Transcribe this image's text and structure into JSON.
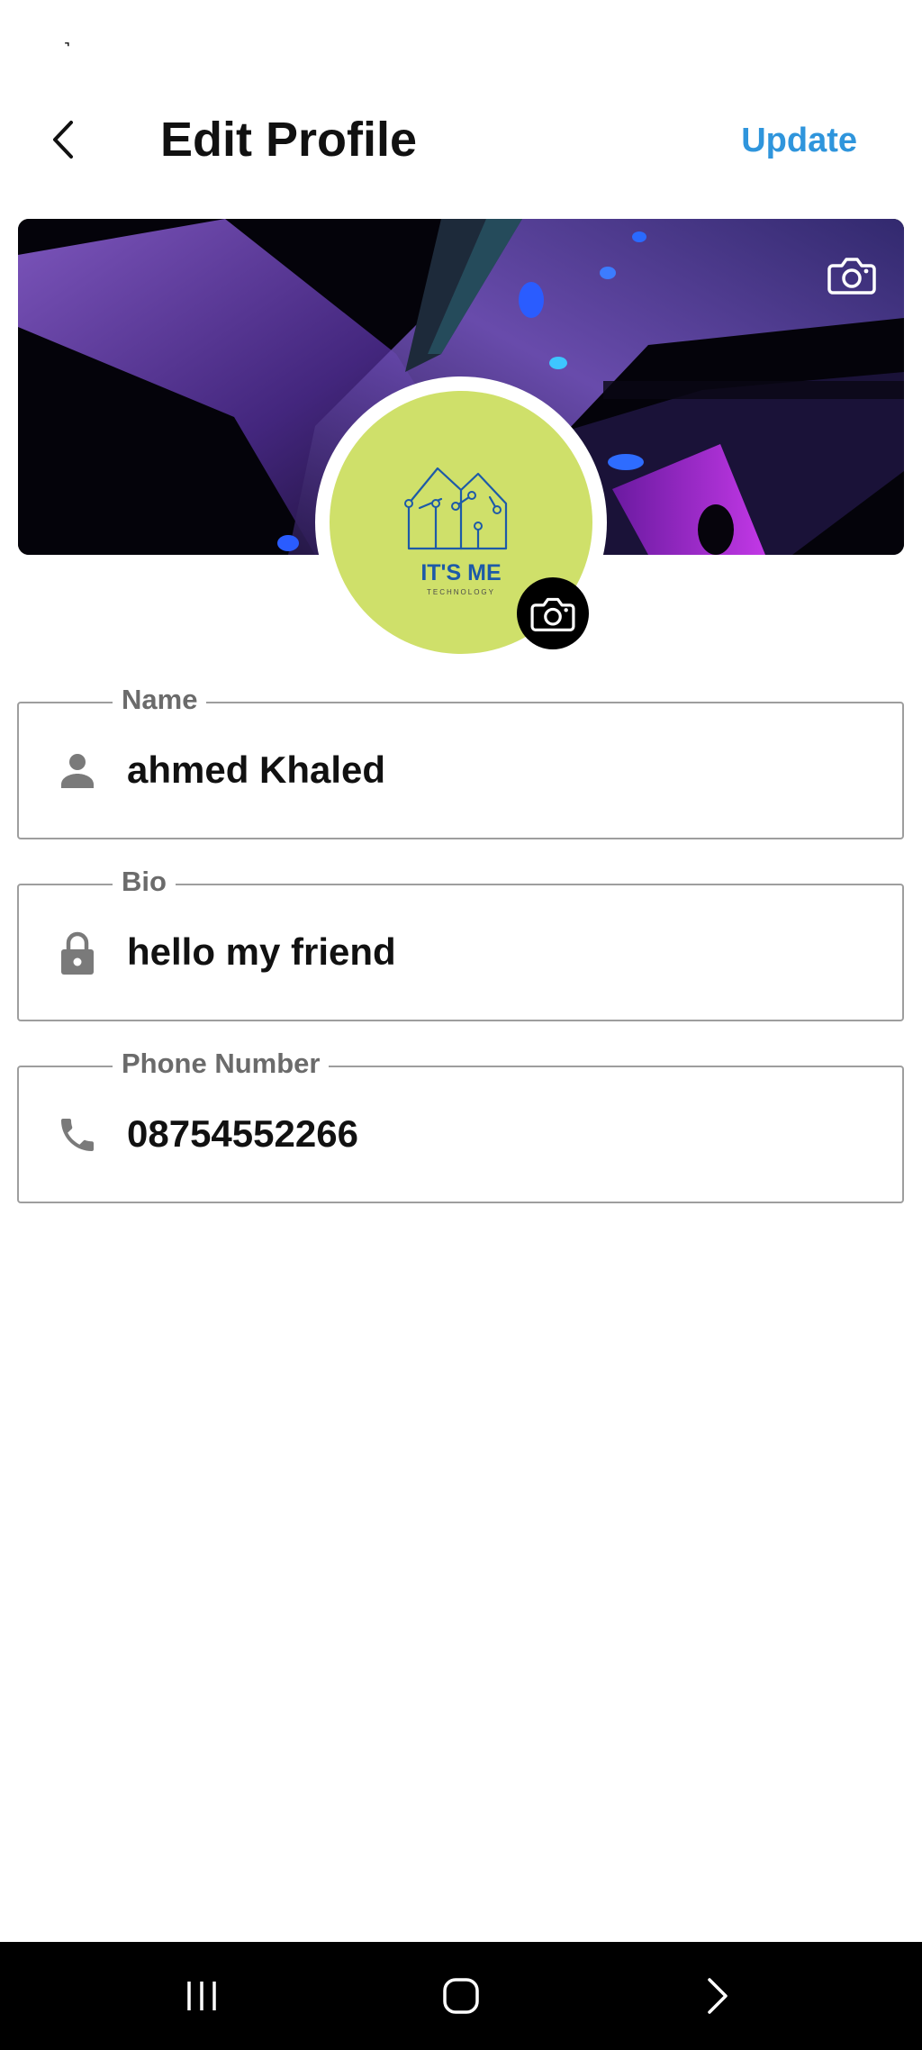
{
  "status_bar": {
    "glyph": "˺"
  },
  "header": {
    "title": "Edit Profile",
    "update_label": "Update",
    "back_icon": "chevron-left-icon"
  },
  "cover": {
    "camera_icon": "camera-icon"
  },
  "avatar": {
    "logo_text": "IT'S ME",
    "logo_subtext": "TECHNOLOGY",
    "camera_icon": "camera-icon"
  },
  "fields": [
    {
      "label": "Name",
      "value": "ahmed Khaled",
      "icon": "person-icon"
    },
    {
      "label": "Bio",
      "value": "hello my friend",
      "icon": "lock-icon"
    },
    {
      "label": "Phone Number",
      "value": "08754552266",
      "icon": "phone-icon"
    }
  ],
  "nav_bar": {
    "recents_icon": "recents-icon",
    "home_icon": "home-icon",
    "back_icon": "nav-back-icon"
  },
  "colors": {
    "accent": "#2f95dc",
    "avatar_bg": "#cfe06a",
    "logo_blue": "#1d5aa8",
    "field_border": "#9e9e9e",
    "label_gray": "#6b6b6b",
    "nav_bg": "#000000"
  }
}
